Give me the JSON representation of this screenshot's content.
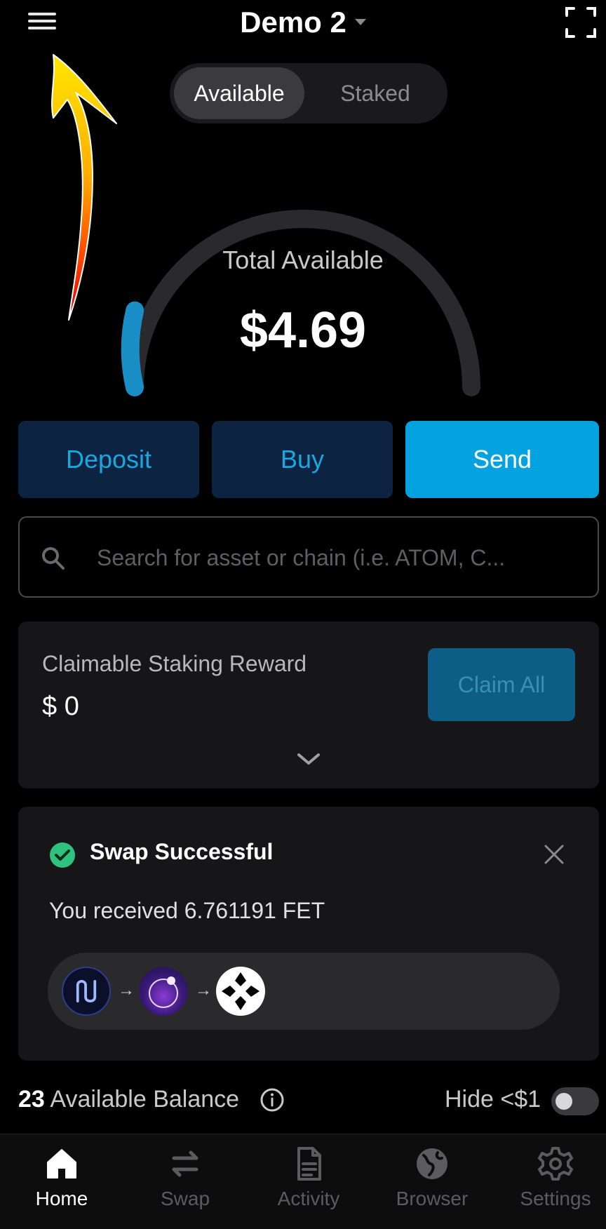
{
  "header": {
    "wallet_name": "Demo 2"
  },
  "balance_toggle": {
    "available": "Available",
    "staked": "Staked"
  },
  "gauge": {
    "label": "Total Available",
    "value": "$4.69",
    "fill_fraction": 0.08,
    "accent": "#1a8fc7"
  },
  "actions": {
    "deposit": "Deposit",
    "buy": "Buy",
    "send": "Send"
  },
  "search": {
    "placeholder": "Search for asset or chain (i.e. ATOM, C..."
  },
  "staking": {
    "title": "Claimable Staking Reward",
    "value": "$ 0",
    "claim_label": "Claim All"
  },
  "swap_notice": {
    "title": "Swap Successful",
    "message": "You received 6.761191 FET",
    "route_tokens": [
      "noble-icon",
      "osmosis-icon",
      "fetch-ai-icon"
    ]
  },
  "balance": {
    "count": "23",
    "label": "Available Balance",
    "hide_label": "Hide <$1"
  },
  "nav": [
    {
      "label": "Home",
      "icon": "home-icon"
    },
    {
      "label": "Swap",
      "icon": "swap-icon"
    },
    {
      "label": "Activity",
      "icon": "activity-icon"
    },
    {
      "label": "Browser",
      "icon": "globe-icon"
    },
    {
      "label": "Settings",
      "icon": "gear-icon"
    }
  ],
  "colors": {
    "primary": "#04a3e0",
    "success": "#2ec27e",
    "background": "#000000"
  }
}
